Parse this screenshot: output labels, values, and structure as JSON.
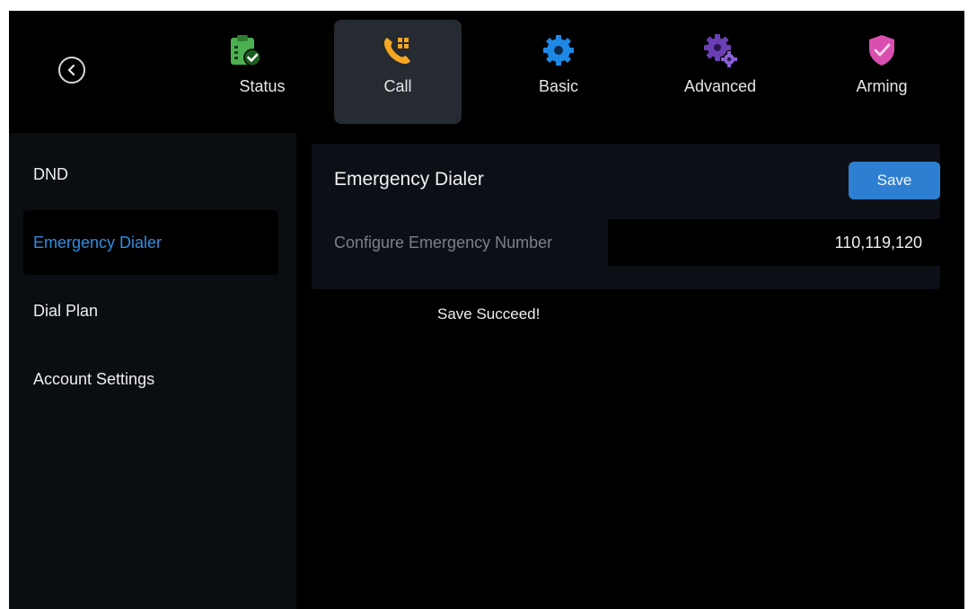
{
  "tabs": [
    {
      "label": "Status",
      "icon": "clipboard-check-icon",
      "color": "#4caf50"
    },
    {
      "label": "Call",
      "icon": "phone-keypad-icon",
      "color": "#f5a623"
    },
    {
      "label": "Basic",
      "icon": "gear-icon",
      "color": "#1e88e5"
    },
    {
      "label": "Advanced",
      "icon": "gears-icon",
      "color": "#6a3fb5"
    },
    {
      "label": "Arming",
      "icon": "shield-check-icon",
      "color": "#d94fb0"
    }
  ],
  "active_tab": "Call",
  "sidebar": {
    "items": [
      {
        "label": "DND"
      },
      {
        "label": "Emergency Dialer"
      },
      {
        "label": "Dial Plan"
      },
      {
        "label": "Account Settings"
      }
    ],
    "active": "Emergency Dialer"
  },
  "panel": {
    "title": "Emergency Dialer",
    "save_label": "Save",
    "field_label": "Configure Emergency Number",
    "field_value": "110,119,120"
  },
  "toast": "Save Succeed!",
  "colors": {
    "accent": "#2e7fd1",
    "active_text": "#2f8ee0",
    "background": "#000000"
  }
}
